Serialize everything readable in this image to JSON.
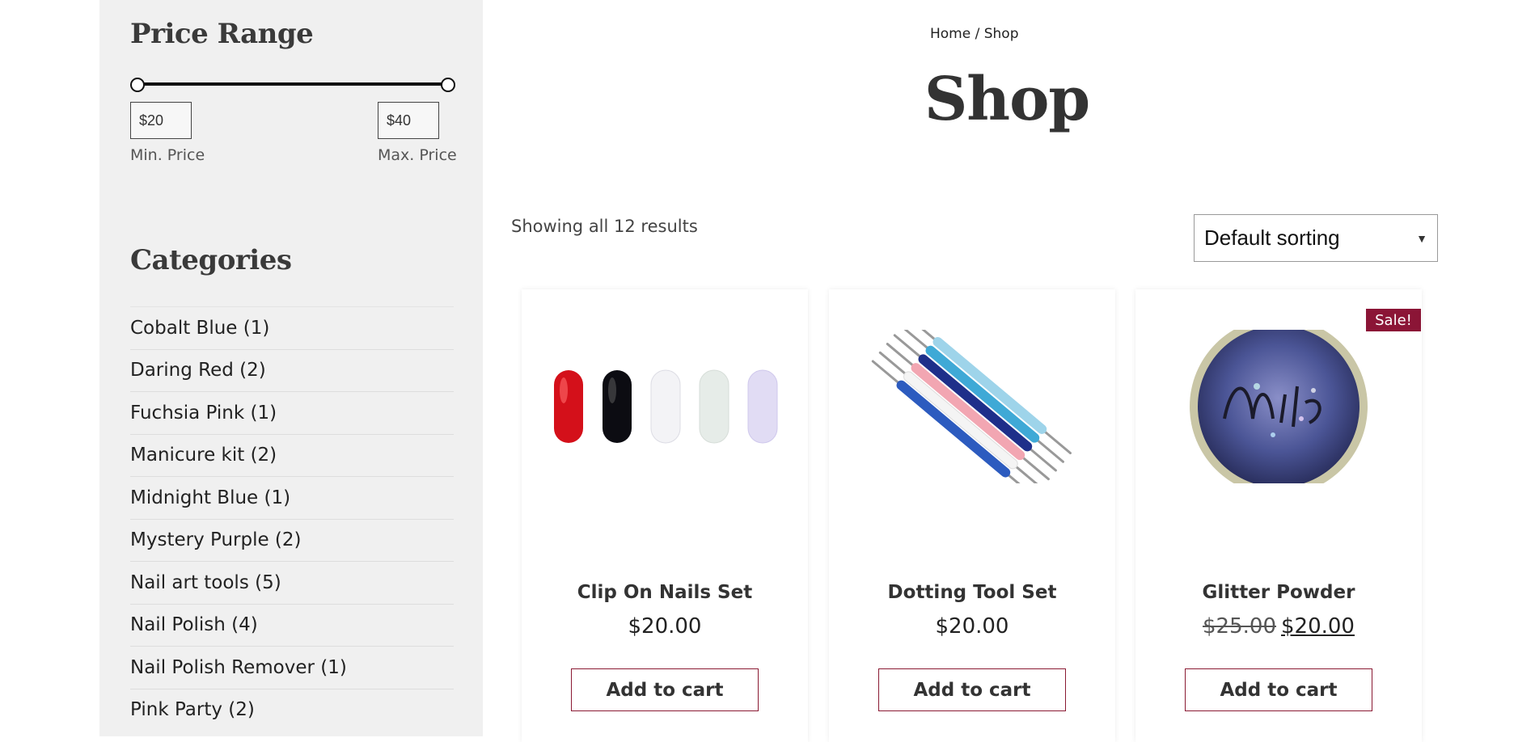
{
  "sidebar": {
    "price_range": {
      "title": "Price Range",
      "min_value": "$20",
      "max_value": "$40",
      "min_label": "Min. Price",
      "max_label": "Max. Price"
    },
    "categories": {
      "title": "Categories",
      "items": [
        {
          "label": "Cobalt Blue (1)"
        },
        {
          "label": "Daring Red (2)"
        },
        {
          "label": "Fuchsia Pink (1)"
        },
        {
          "label": "Manicure kit (2)"
        },
        {
          "label": "Midnight Blue (1)"
        },
        {
          "label": "Mystery Purple (2)"
        },
        {
          "label": "Nail art tools (5)"
        },
        {
          "label": "Nail Polish (4)"
        },
        {
          "label": "Nail Polish Remover (1)"
        },
        {
          "label": "Pink Party (2)"
        }
      ]
    }
  },
  "breadcrumb": "Home / Shop",
  "page_title": "Shop",
  "results_text": "Showing all 12 results",
  "sorting": {
    "selected": "Default sorting"
  },
  "products": [
    {
      "name": "Clip On Nails Set",
      "price": "$20.00",
      "button": "Add to cart",
      "image_icon": "nail-tips-image"
    },
    {
      "name": "Dotting Tool Set",
      "price": "$20.00",
      "button": "Add to cart",
      "image_icon": "dotting-tools-image"
    },
    {
      "name": "Glitter Powder",
      "old_price": "$25.00",
      "price": "$20.00",
      "button": "Add to cart",
      "badge": "Sale!",
      "image_icon": "glitter-jar-image"
    }
  ],
  "colors": {
    "accent": "#8b1536",
    "sidebar_bg": "#f0f0f0",
    "text": "#333333"
  }
}
